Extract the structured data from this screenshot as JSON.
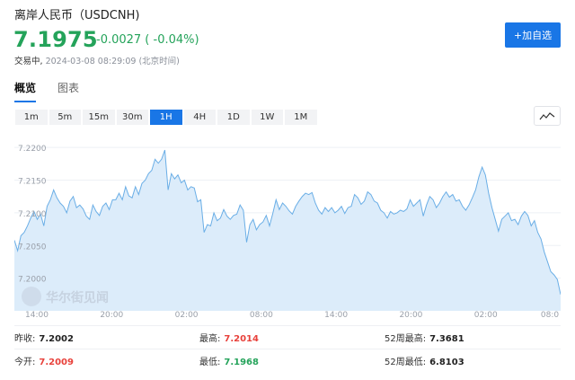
{
  "header": {
    "title": "离岸人民币（USDCNH)",
    "price": "7.1975",
    "change": "-0.0027 ( -0.04%)",
    "status_label": "交易中,",
    "timestamp": "2024-03-08 08:29:09 (北京时间)",
    "add_watchlist_label": "+加自选",
    "accent_color": "#1976e6",
    "down_color": "#24a35a",
    "up_color": "#e8413b"
  },
  "tabs": [
    {
      "label": "概览",
      "active": true
    },
    {
      "label": "图表",
      "active": false
    }
  ],
  "intervals": [
    {
      "label": "1m",
      "active": false
    },
    {
      "label": "5m",
      "active": false
    },
    {
      "label": "15m",
      "active": false
    },
    {
      "label": "30m",
      "active": false
    },
    {
      "label": "1H",
      "active": true
    },
    {
      "label": "4H",
      "active": false
    },
    {
      "label": "1D",
      "active": false
    },
    {
      "label": "1W",
      "active": false
    },
    {
      "label": "1M",
      "active": false
    }
  ],
  "chart_toggle_icon": "line-chart-icon",
  "watermark": "华尔街见闻",
  "chart_data": {
    "type": "area",
    "title": "",
    "xlabel": "",
    "ylabel": "",
    "ylim": [
      7.195,
      7.2225
    ],
    "y_ticks": [
      "7.2200",
      "7.2150",
      "7.2100",
      "7.2050",
      "7.2000"
    ],
    "y_tick_values": [
      7.22,
      7.215,
      7.21,
      7.205,
      7.2
    ],
    "x_ticks": [
      "14:00",
      "20:00",
      "02:00",
      "08:00",
      "14:00",
      "20:00",
      "02:00",
      "08:0"
    ],
    "grid": true,
    "line_color": "#6aaee6",
    "fill_color": "#dcecfa",
    "series": [
      {
        "values": [
          7.2058,
          7.2042,
          7.2065,
          7.207,
          7.208,
          7.2092,
          7.2102,
          7.209,
          7.2098,
          7.208,
          7.211,
          7.212,
          7.2135,
          7.2123,
          7.2115,
          7.211,
          7.21,
          7.2118,
          7.2125,
          7.2108,
          7.2112,
          7.2106,
          7.2095,
          7.209,
          7.2112,
          7.2102,
          7.2096,
          7.211,
          7.2115,
          7.2105,
          7.212,
          7.212,
          7.213,
          7.212,
          7.214,
          7.2126,
          7.2123,
          7.214,
          7.2128,
          7.2145,
          7.215,
          7.216,
          7.2165,
          7.2182,
          7.2176,
          7.2182,
          7.2196,
          7.2135,
          7.216,
          7.2152,
          7.2158,
          7.2146,
          7.215,
          7.2135,
          7.214,
          7.2138,
          7.2117,
          7.212,
          7.207,
          7.2082,
          7.208,
          7.21,
          7.2088,
          7.2092,
          7.2105,
          7.2095,
          7.209,
          7.2096,
          7.2098,
          7.2112,
          7.2104,
          7.2055,
          7.2082,
          7.209,
          7.2074,
          7.2082,
          7.2086,
          7.2096,
          7.208,
          7.2099,
          7.212,
          7.2105,
          7.2115,
          7.211,
          7.2103,
          7.2098,
          7.211,
          7.2118,
          7.2125,
          7.213,
          7.2128,
          7.2131,
          7.2115,
          7.2104,
          7.2098,
          7.2108,
          7.2102,
          7.2108,
          7.21,
          7.2104,
          7.211,
          7.2099,
          7.2108,
          7.211,
          7.2128,
          7.2123,
          7.2113,
          7.2118,
          7.2132,
          7.2128,
          7.2118,
          7.2115,
          7.2104,
          7.21,
          7.2092,
          7.2102,
          7.2098,
          7.21,
          7.2104,
          7.2102,
          7.2106,
          7.212,
          7.211,
          7.2115,
          7.212,
          7.2095,
          7.2112,
          7.2125,
          7.212,
          7.2108,
          7.2115,
          7.2125,
          7.2132,
          7.2124,
          7.2128,
          7.2118,
          7.212,
          7.211,
          7.2104,
          7.2112,
          7.2123,
          7.2135,
          7.2155,
          7.217,
          7.2158,
          7.213,
          7.2108,
          7.209,
          7.2072,
          7.209,
          7.2095,
          7.21,
          7.2088,
          7.209,
          7.2082,
          7.2095,
          7.2102,
          7.2096,
          7.208,
          7.2088,
          7.207,
          7.206,
          7.204,
          7.2025,
          7.201,
          7.2005,
          7.1998,
          7.1975
        ]
      }
    ]
  },
  "stats": [
    [
      {
        "label": "昨收:",
        "value": "7.2002",
        "tone": "neutral"
      },
      {
        "label": "最高:",
        "value": "7.2014",
        "tone": "red"
      },
      {
        "label": "52周最高:",
        "value": "7.3681",
        "tone": "neutral"
      }
    ],
    [
      {
        "label": "今开:",
        "value": "7.2009",
        "tone": "red"
      },
      {
        "label": "最低:",
        "value": "7.1968",
        "tone": "green"
      },
      {
        "label": "52周最低:",
        "value": "6.8103",
        "tone": "neutral"
      }
    ]
  ]
}
